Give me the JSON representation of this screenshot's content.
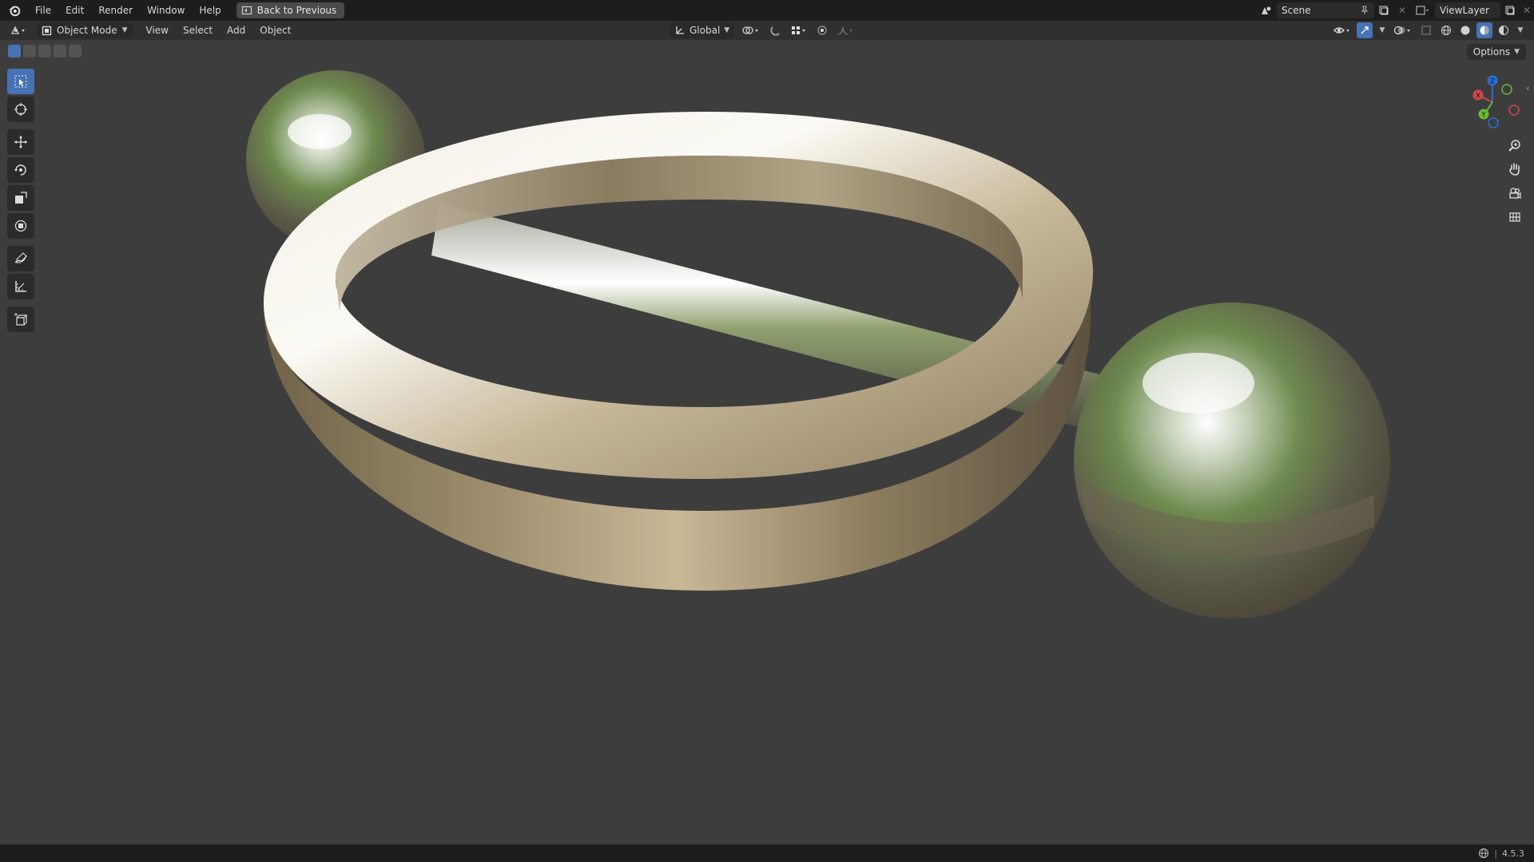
{
  "menubar": {
    "items": [
      "File",
      "Edit",
      "Render",
      "Window",
      "Help"
    ],
    "back_button": "Back to Previous",
    "scene": "Scene",
    "view_layer": "ViewLayer"
  },
  "viewport_header": {
    "mode": "Object Mode",
    "menus": [
      "View",
      "Select",
      "Add",
      "Object"
    ],
    "transform_orientation": "Global",
    "options": "Options"
  },
  "gizmo": {
    "x_label": "X",
    "y_label": "Y",
    "z_label": "Z"
  },
  "statusbar": {
    "version": "4.5.3"
  },
  "colors": {
    "accent": "#4772b3",
    "background": "#3d3d3d",
    "header": "#1d1d1d"
  }
}
